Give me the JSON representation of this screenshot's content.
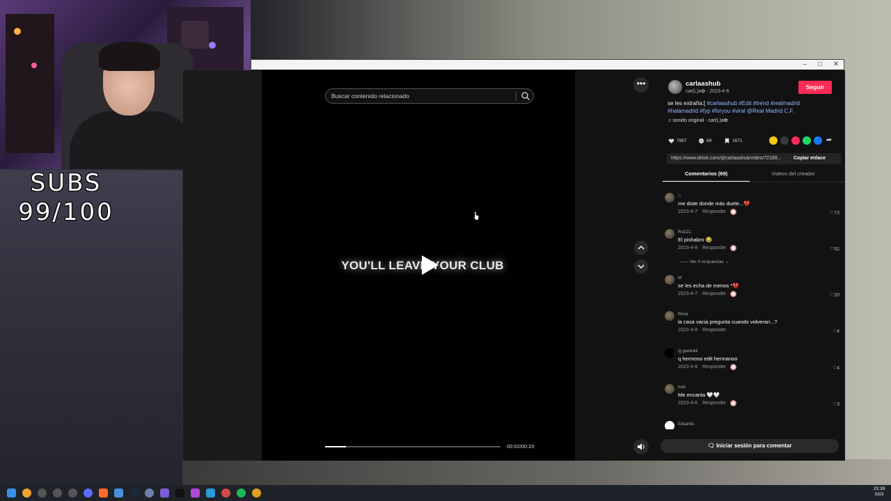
{
  "overlay": {
    "subs_label": "SUBS",
    "subs_count": "99/100"
  },
  "search": {
    "placeholder": "Buscar contenido relacionado"
  },
  "video": {
    "caption": "YOU'LL LEAVE YOUR CLUB",
    "time": "00:02/00:20",
    "progress": 0.12
  },
  "author": {
    "name": "carlaashub",
    "handle": "car(L)a✿",
    "date": "2023-4-6",
    "follow_label": "Seguir"
  },
  "description": {
    "text": "se les extraña:[",
    "tags": [
      "#carlaashub",
      "#Edit",
      "#trend",
      "#realmadrid",
      "#halamadrid",
      "#fyp",
      "#foryou",
      "#viral",
      "@Real Madrid C.F."
    ]
  },
  "sound": "sonido original - car(L)a✿",
  "stats": {
    "likes": "7887",
    "comments": "69",
    "saves": "1671"
  },
  "link": {
    "url": "https://www.tiktok.com/@carlaashub/video/72189...",
    "copy_label": "Copiar enlace"
  },
  "tabs": {
    "comments": "Comentarios (69)",
    "creator": "Videos del creador"
  },
  "comments": [
    {
      "user": "□",
      "text": "me diste donde más duele...💔",
      "date": "2023-4-7",
      "reply": "Responder",
      "likes": "73"
    },
    {
      "user": "RulzZz.",
      "text": "El pishabro 😂",
      "date": "2023-4-9",
      "reply": "Responder",
      "likes": "52"
    },
    {
      "user": "M",
      "text": "se les echa de menos *💔",
      "date": "2023-4-7",
      "reply": "Responder",
      "likes": "20"
    },
    {
      "user": "Rena",
      "text": "la casa vacia pregunta cuando volveran...?",
      "date": "2023-4-8",
      "reply": "Responder",
      "likes": "4"
    },
    {
      "user": "ig gaeltukii",
      "text": "q hermoso edit hermanoo",
      "date": "2023-4-8",
      "reply": "Responder",
      "likes": "4"
    },
    {
      "user": "meli",
      "text": "Me encanta 🤍🤍",
      "date": "2023-4-6",
      "reply": "Responder",
      "likes": "3"
    },
    {
      "user": "Eduardo.",
      "text": "",
      "date": "",
      "reply": "",
      "likes": ""
    }
  ],
  "view_replies": "Ver 4 respuestas",
  "login_comment": "Iniciar sesión para comentar",
  "taskbar": {
    "time": "21:39",
    "date": "02/2"
  },
  "colors": {
    "accent": "#fe2c55",
    "tag": "#8fb8ff",
    "background": "#121212"
  }
}
